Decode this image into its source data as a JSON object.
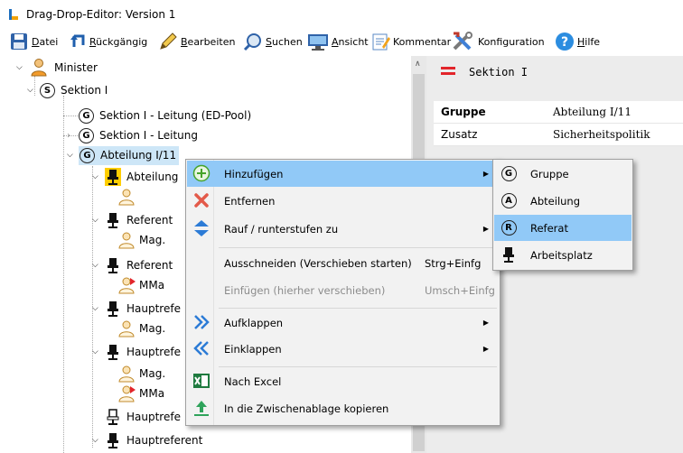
{
  "window": {
    "title": "Drag-Drop-Editor: Version 1"
  },
  "toolbar": {
    "items": [
      {
        "first": "D",
        "rest": "atei",
        "icon": "save-icon"
      },
      {
        "first": "R",
        "rest": "ückgängig",
        "icon": "undo-icon"
      },
      {
        "first": "B",
        "rest": "earbeiten",
        "icon": "pencil-icon"
      },
      {
        "first": "S",
        "rest": "uchen",
        "icon": "search-icon"
      },
      {
        "first": "A",
        "rest": "nsicht",
        "icon": "monitor-icon"
      },
      {
        "first": "",
        "rest": "Kommentar",
        "icon": "comment-icon"
      },
      {
        "first": "",
        "rest": "Konfiguration",
        "icon": "tools-icon"
      },
      {
        "first": "H",
        "rest": "ilfe",
        "icon": "help-icon"
      }
    ]
  },
  "tree": {
    "minister": "Minister",
    "sektion": "Sektion I",
    "sektion_leitung_ed": "Sektion I - Leitung (ED-Pool)",
    "sektion_leitung": "Sektion I - Leitung",
    "abteilung": "Abteilung I/11",
    "abteilung_leitung": "Abteilung",
    "referent1": "Referent",
    "mag1": "Mag.",
    "referent2": "Referent",
    "mma1": "MMa",
    "hauptref1": "Hauptrefe",
    "mag2": "Mag.",
    "hauptref2": "Hauptrefe",
    "mag3": "Mag.",
    "mma2": "MMa",
    "hauptref3": "Hauptrefe",
    "hauptref4": "Hauptreferent",
    "circle_s": "S",
    "circle_g": "G"
  },
  "detail": {
    "header": "Sektion I",
    "rows": [
      {
        "key": "Gruppe",
        "value": "Abteilung I/11",
        "bold": true
      },
      {
        "key": "Zusatz",
        "value": "Sicherheitspolitik",
        "bold": false
      }
    ]
  },
  "context_menu": {
    "items": [
      {
        "label": "Hinzufügen",
        "shortcut": "",
        "icon": "plus-circle-icon",
        "submenu": true
      },
      {
        "label": "Entfernen",
        "shortcut": "",
        "icon": "remove-icon",
        "submenu": false
      },
      {
        "label": "Rauf / runterstufen zu",
        "shortcut": "",
        "icon": "updown-icon",
        "submenu": true
      },
      {
        "label": "Ausschneiden (Verschieben starten)",
        "shortcut": "Strg+Einfg",
        "icon": "",
        "submenu": false
      },
      {
        "label": "Einfügen (hierher verschieben)",
        "shortcut": "Umsch+Einfg",
        "icon": "",
        "submenu": false
      },
      {
        "label": "Aufklappen",
        "shortcut": "",
        "icon": "expand-icon",
        "submenu": true
      },
      {
        "label": "Einklappen",
        "shortcut": "",
        "icon": "collapse-icon",
        "submenu": true
      },
      {
        "label": "Nach Excel",
        "shortcut": "",
        "icon": "excel-icon",
        "submenu": false
      },
      {
        "label": "In die Zwischenablage kopieren",
        "shortcut": "",
        "icon": "clipboard-upload-icon",
        "submenu": false
      }
    ]
  },
  "submenu": {
    "items": [
      {
        "label": "Gruppe",
        "badge": "G"
      },
      {
        "label": "Abteilung",
        "badge": "A"
      },
      {
        "label": "Referat",
        "badge": "R"
      },
      {
        "label": "Arbeitsplatz",
        "badge": ""
      }
    ]
  },
  "colors": {
    "selection": "#cde6f7",
    "menu_hover": "#91c9f7",
    "highlight": "#ffcd00",
    "flag_red": "#e2252b"
  }
}
